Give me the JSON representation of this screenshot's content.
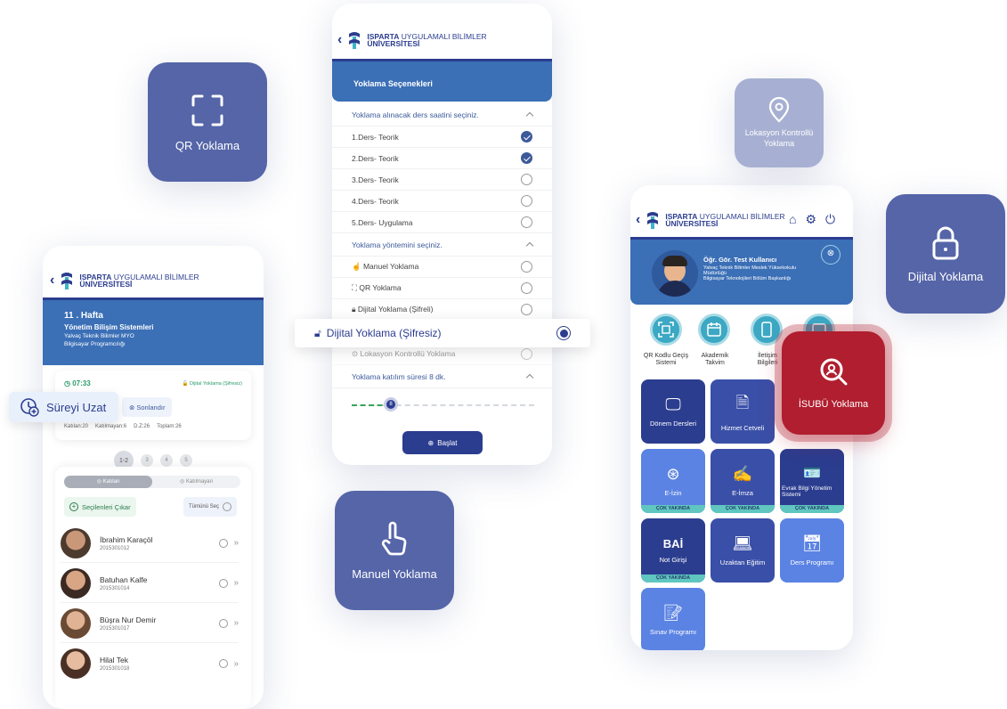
{
  "logo": {
    "line1_bold": "ISPARTA",
    "line1_rest": " UYGULAMALI BİLİMLER",
    "line2": "ÜNİVERSİTESİ"
  },
  "tiles": {
    "qr": "QR Yoklama",
    "lokasyon": "Lokasyon Kontrollü Yoklama",
    "dijital": "Dijital Yoklama",
    "manuel": "Manuel Yoklama",
    "isubu": "İSUBÜ Yoklama"
  },
  "left_phone": {
    "week": "11 . Hafta",
    "course": "Yönetim Bilişim Sistemleri",
    "school": "Yalvaç Teknik Bilimler MYO",
    "program": "Bilgisayar Programcılığı",
    "time": "07:33",
    "mode": "Dijital Yoklama (Şifresiz)",
    "extend": "Süreyi Uzat",
    "finish": "Sonlandır",
    "stats": [
      "Katılan:20",
      "Katılmayan:6",
      "D.Z:26",
      "Toplam:26"
    ],
    "pages": [
      "1-2",
      "3",
      "4",
      "5"
    ],
    "tab_present": "Katılan",
    "tab_absent": "Katılmayan",
    "remove_selected": "Seçilenleri Çıkar",
    "select_all": "Tümünü Seç",
    "students": [
      {
        "name": "İbrahim Karaçöl",
        "number": "2015301012"
      },
      {
        "name": "Batuhan Kalfe",
        "number": "2015301014"
      },
      {
        "name": "Büşra Nur Demir",
        "number": "2015301017"
      },
      {
        "name": "Hilal Tek",
        "number": "2015301018"
      }
    ]
  },
  "middle_phone": {
    "header": "Yoklama Seçenekleri",
    "hours_prompt": "Yoklama alınacak ders saatini seçiniz.",
    "hours": [
      {
        "label": "1.Ders- Teorik",
        "checked": true
      },
      {
        "label": "2.Ders- Teorik",
        "checked": true
      },
      {
        "label": "3.Ders- Teorik",
        "checked": false
      },
      {
        "label": "4.Ders- Teorik",
        "checked": false
      },
      {
        "label": "5.Ders- Uygulama",
        "checked": false
      }
    ],
    "method_prompt": "Yoklama yöntemini seçiniz.",
    "methods": {
      "manuel": "Manuel Yoklama",
      "qr": "QR Yoklama",
      "sifreli": "Dijital Yoklama (Şifreli)",
      "sifresiz": "Dijital Yoklama (Şifresiz)",
      "lokasyon": "Lokasyon Kontrollü Yoklama"
    },
    "duration_prompt": "Yoklama katılım süresi 8 dk.",
    "duration_value": "8",
    "start": "Başlat"
  },
  "right_phone": {
    "user_title": "Öğr. Gör. Test Kullanıcı",
    "user_line1": "Yalvaç Teknik Bilimler Meslek Yüksekokulu",
    "user_line2": "Müdürlüğü",
    "user_line3": "Bilgisayar Teknolojileri Bölüm Başkanlığı",
    "quick": {
      "qr": "QR Kodlu Geçiş Sistemi",
      "takvim": "Akademik Takvim",
      "iletisim": "İletişim Bilgileri"
    },
    "grid": {
      "donem": "Dönem Dersleri",
      "hizmet": "Hizmet Cetveli",
      "eizin": "E-İzin",
      "eimza": "E-İmza",
      "evrak": "Evrak Bilgi Yönetim Sistemi",
      "bai": "BAİ",
      "not": "Not Girişi",
      "uzaktan": "Uzaktan Eğitim",
      "ders": "Ders Programı",
      "sinav": "Sınav Programı",
      "soon": "ÇOK YAKINDA"
    }
  },
  "colors": {
    "brand": "#2b3d8f",
    "tile": "#5565a8",
    "accent_red": "#b01e2f",
    "header_blue": "#3b6fb6"
  }
}
